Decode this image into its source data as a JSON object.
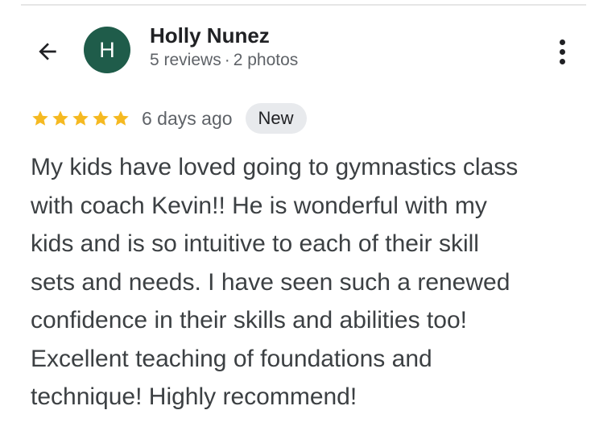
{
  "reviewer": {
    "avatar_initial": "H",
    "name": "Holly Nunez",
    "reviews": "5 reviews",
    "separator": "·",
    "photos": "2 photos"
  },
  "rating": {
    "stars": 5,
    "max_stars": 5,
    "time_ago": "6 days ago",
    "badge": "New"
  },
  "review": {
    "text": "My kids have loved going to gymnastics class\nwith coach Kevin!! He is wonderful with my\nkids and is so intuitive to each of their skill\nsets and needs. I have seen such a renewed\nconfidence in their skills and abilities too!\nExcellent teaching of foundations and\ntechnique! Highly recommend!"
  },
  "icons": {
    "back": "arrow-back-icon",
    "more": "more-vert-icon",
    "star": "star-icon"
  },
  "colors": {
    "avatar_bg": "#1f5c4a",
    "star": "#f5b921",
    "badge_bg": "#e8eaed",
    "secondary_text": "#5f6368"
  }
}
